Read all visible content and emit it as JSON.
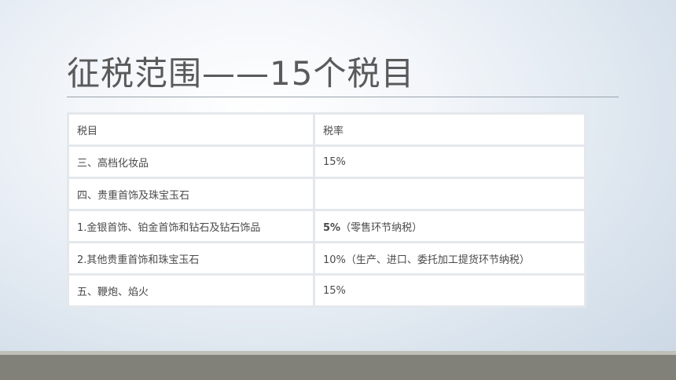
{
  "slide": {
    "title": "征税范围——15个税目"
  },
  "table": {
    "headers": [
      "税目",
      "税率"
    ],
    "rows": [
      {
        "item": "三、高档化妆品",
        "rate_bold": "",
        "rate": "15%"
      },
      {
        "item": "四、贵重首饰及珠宝玉石",
        "rate_bold": "",
        "rate": ""
      },
      {
        "item": "1.金银首饰、铂金首饰和钻石及钻石饰品",
        "rate_bold": "5%",
        "rate": "（零售环节纳税）"
      },
      {
        "item": "2.其他贵重首饰和珠宝玉石",
        "rate_bold": "",
        "rate": "10%（生产、进口、委托加工提货环节纳税）"
      },
      {
        "item": "五、鞭炮、焰火",
        "rate_bold": "",
        "rate": "15%"
      }
    ]
  }
}
